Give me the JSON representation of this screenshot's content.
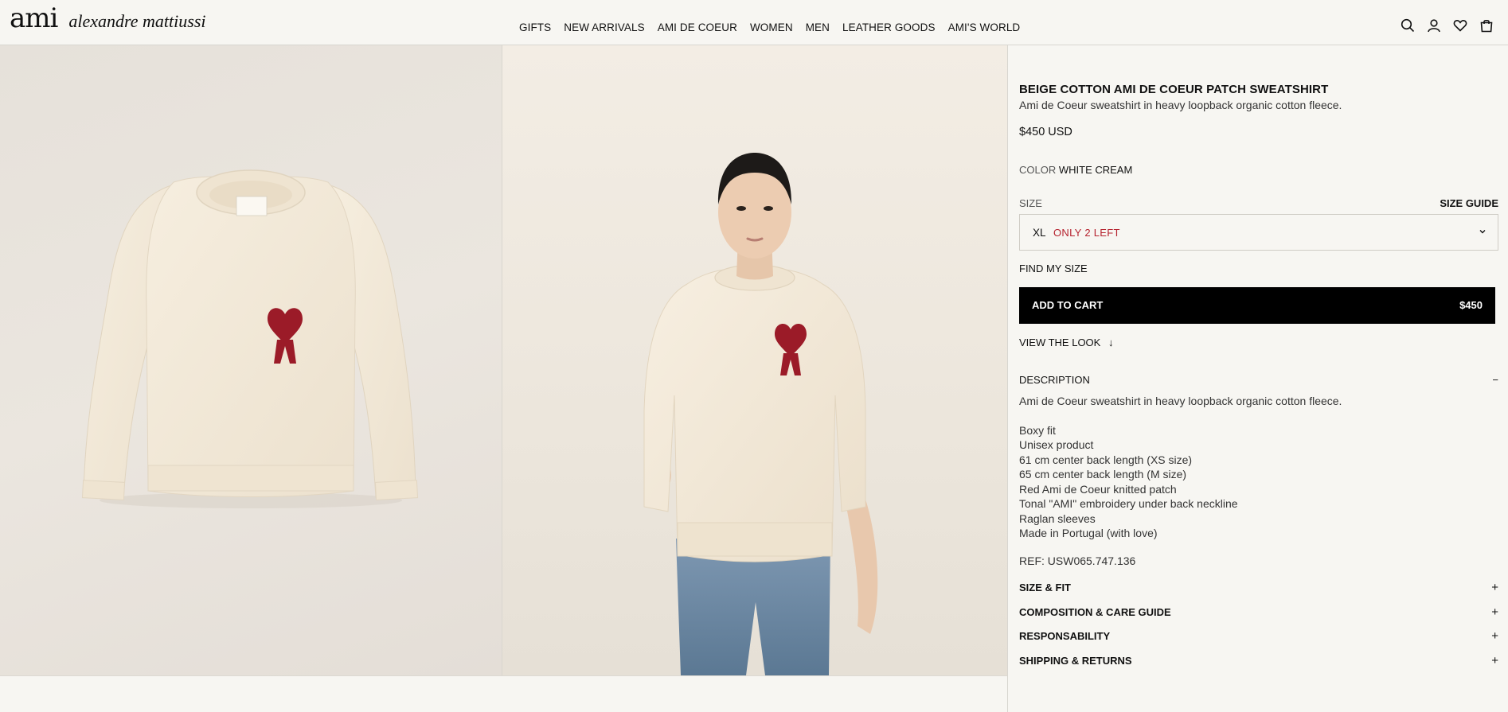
{
  "brand": {
    "logo_mark": "ami",
    "logo_name": "alexandre mattiussi"
  },
  "nav": [
    "GIFTS",
    "NEW ARRIVALS",
    "AMI DE COEUR",
    "WOMEN",
    "MEN",
    "LEATHER GOODS",
    "AMI'S WORLD"
  ],
  "header_icons": [
    "search-icon",
    "account-icon",
    "wishlist-heart-icon",
    "shopping-bag-icon"
  ],
  "product": {
    "title": "BEIGE COTTON AMI DE COEUR PATCH SWEATSHIRT",
    "subtitle": "Ami de Coeur sweatshirt in heavy loopback organic cotton fleece.",
    "price": "$450 USD",
    "color_label": "COLOR",
    "color_value": "WHITE CREAM",
    "size_label": "SIZE",
    "size_guide": "SIZE GUIDE",
    "size_selected": "XL",
    "stock_note": "ONLY 2 LEFT",
    "find_my_size": "FIND MY SIZE",
    "add_to_cart": "ADD TO CART",
    "cart_price": "$450",
    "view_look": "VIEW THE LOOK",
    "view_look_arrow": "↓",
    "description_label": "DESCRIPTION",
    "description_toggle": "−",
    "description_intro": "Ami de Coeur sweatshirt in heavy loopback organic cotton fleece.",
    "description_lines": [
      "Boxy fit",
      "Unisex product",
      "61 cm center back length (XS size)",
      "65 cm center back length (M size)",
      "Red Ami de Coeur knitted patch",
      "Tonal \"AMI\" embroidery under back neckline",
      "Raglan sleeves",
      "Made in Portugal (with love)"
    ],
    "ref": "REF: USW065.747.136"
  },
  "accordions": [
    {
      "label": "SIZE & FIT",
      "toggle": "+"
    },
    {
      "label": "COMPOSITION & CARE GUIDE",
      "toggle": "+"
    },
    {
      "label": "RESPONSABILITY",
      "toggle": "+"
    },
    {
      "label": "SHIPPING & RETURNS",
      "toggle": "+"
    }
  ],
  "colors": {
    "accent_red": "#b5232f",
    "patch_red": "#9b1b28",
    "sweatshirt_cream": "#f4ead8",
    "button_black": "#000000"
  }
}
